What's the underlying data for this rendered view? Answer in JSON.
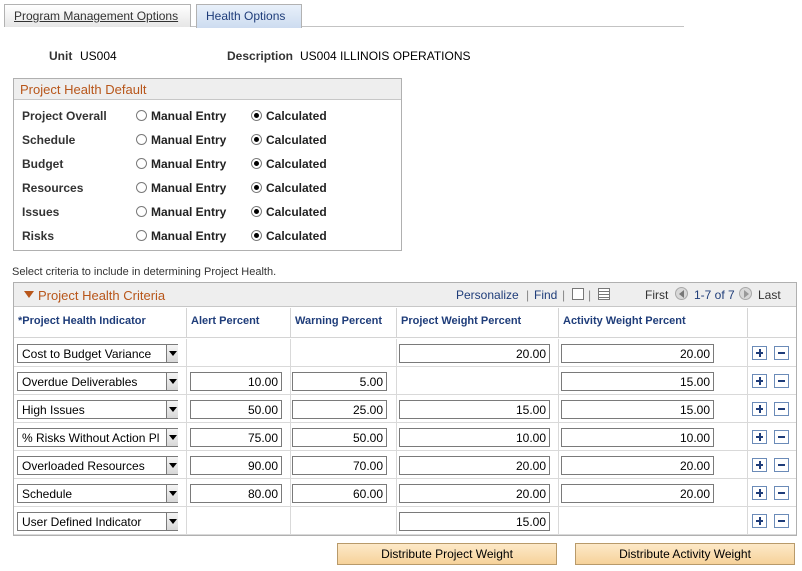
{
  "tabs": [
    {
      "label": "Program Management Options"
    },
    {
      "label": "Health Options"
    }
  ],
  "unit": {
    "label": "Unit",
    "value": "US004"
  },
  "description": {
    "label": "Description",
    "value": "US004 ILLINOIS OPERATIONS"
  },
  "project_health_default": {
    "title": "Project Health Default",
    "option_manual": "Manual Entry",
    "option_calculated": "Calculated",
    "rows": [
      {
        "label": "Project Overall",
        "selected": "Calculated"
      },
      {
        "label": "Schedule",
        "selected": "Calculated"
      },
      {
        "label": "Budget",
        "selected": "Calculated"
      },
      {
        "label": "Resources",
        "selected": "Calculated"
      },
      {
        "label": "Issues",
        "selected": "Calculated"
      },
      {
        "label": "Risks",
        "selected": "Calculated"
      }
    ]
  },
  "hint": "Select criteria to include in determining Project Health.",
  "grid": {
    "title": "Project Health Criteria",
    "personalize": "Personalize",
    "find": "Find",
    "sep": "|",
    "first": "First",
    "range": "1-7 of 7",
    "last": "Last",
    "columns": {
      "indicator": "*Project Health Indicator",
      "alert": "Alert Percent",
      "warning": "Warning Percent",
      "project_weight": "Project Weight Percent",
      "activity_weight": "Activity Weight Percent"
    },
    "rows": [
      {
        "indicator": "Cost to Budget Variance",
        "alert": "",
        "warning": "",
        "project_weight": "20.00",
        "activity_weight": "20.00"
      },
      {
        "indicator": "Overdue Deliverables",
        "alert": "10.00",
        "warning": "5.00",
        "project_weight": "",
        "activity_weight": "15.00"
      },
      {
        "indicator": "High Issues",
        "alert": "50.00",
        "warning": "25.00",
        "project_weight": "15.00",
        "activity_weight": "15.00"
      },
      {
        "indicator": "% Risks Without Action Pl",
        "alert": "75.00",
        "warning": "50.00",
        "project_weight": "10.00",
        "activity_weight": "10.00"
      },
      {
        "indicator": "Overloaded Resources",
        "alert": "90.00",
        "warning": "70.00",
        "project_weight": "20.00",
        "activity_weight": "20.00"
      },
      {
        "indicator": "Schedule",
        "alert": "80.00",
        "warning": "60.00",
        "project_weight": "20.00",
        "activity_weight": "20.00"
      },
      {
        "indicator": "User Defined Indicator",
        "alert": "",
        "warning": "",
        "project_weight": "15.00",
        "activity_weight": ""
      }
    ]
  },
  "buttons": {
    "distribute_project": "Distribute Project Weight",
    "distribute_activity": "Distribute Activity Weight"
  },
  "colors": {
    "section_title": "#b8561a",
    "link": "#1f3d7a"
  }
}
